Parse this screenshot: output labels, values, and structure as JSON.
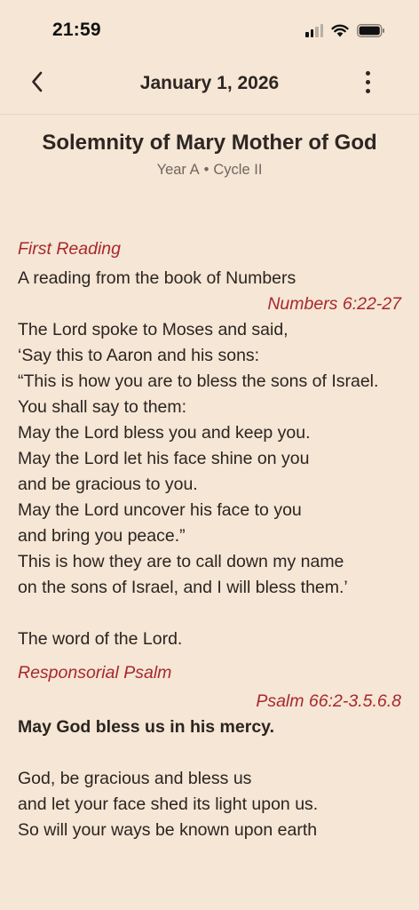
{
  "status": {
    "time": "21:59"
  },
  "nav": {
    "title": "January 1, 2026"
  },
  "header": {
    "title": "Solemnity of Mary Mother of God",
    "year": "Year A",
    "cycle": "Cycle II",
    "separator": "•"
  },
  "first_reading": {
    "label": "First Reading",
    "intro": "A reading from the book of Numbers",
    "citation": "Numbers 6:22-27",
    "lines": [
      "The Lord spoke to Moses and said,",
      "‘Say this to Aaron and his sons:",
      "“This is how you are to bless the sons of Israel.",
      "You shall say to them:",
      "May the Lord bless you and keep you.",
      "May the Lord let his face shine on you",
      "and be gracious to you.",
      "May the Lord uncover his face to you",
      "and bring you peace.”",
      "This is how they are to call down my name",
      "on the sons of Israel, and I will bless them.’"
    ],
    "closing": "The word of the Lord."
  },
  "psalm": {
    "label": "Responsorial Psalm",
    "citation": "Psalm 66:2-3.5.6.8",
    "response": "May God bless us in his mercy.",
    "lines": [
      "God, be gracious and bless us",
      "and let your face shed its light upon us.",
      "So will your ways be known upon earth"
    ]
  },
  "colors": {
    "background": "#f5e6d5",
    "accent": "#a8282e",
    "text": "#2b2420"
  }
}
